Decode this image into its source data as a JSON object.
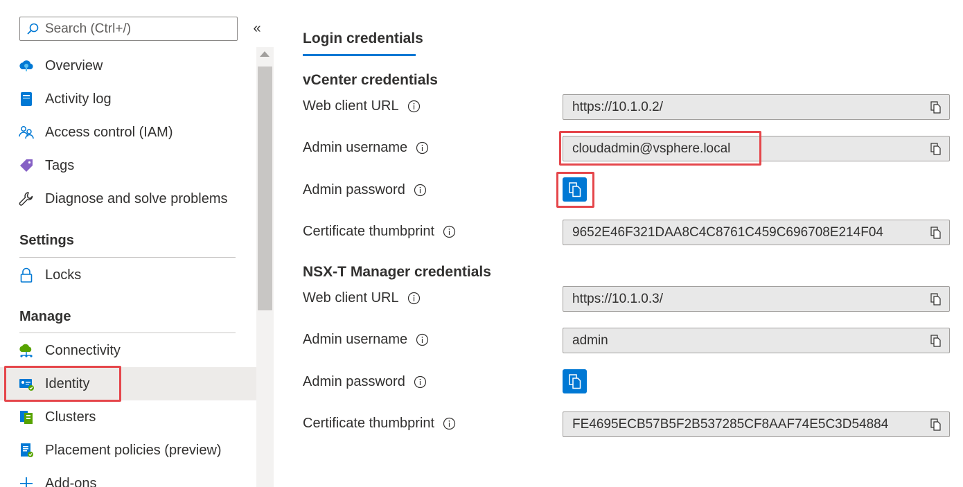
{
  "search": {
    "placeholder": "Search (Ctrl+/)"
  },
  "sidebar": {
    "collapse_glyph": "«",
    "items": [
      {
        "label": "Overview",
        "icon": "overview-cloud-icon"
      },
      {
        "label": "Activity log",
        "icon": "activity-log-icon"
      },
      {
        "label": "Access control (IAM)",
        "icon": "people-icon"
      },
      {
        "label": "Tags",
        "icon": "tag-icon"
      },
      {
        "label": "Diagnose and solve problems",
        "icon": "wrench-icon"
      }
    ],
    "sections": [
      {
        "title": "Settings",
        "items": [
          {
            "label": "Locks",
            "icon": "lock-icon"
          }
        ]
      },
      {
        "title": "Manage",
        "items": [
          {
            "label": "Connectivity",
            "icon": "connectivity-icon"
          },
          {
            "label": "Identity",
            "icon": "identity-card-icon",
            "active": true
          },
          {
            "label": "Clusters",
            "icon": "clusters-icon"
          },
          {
            "label": "Placement policies (preview)",
            "icon": "policy-icon"
          },
          {
            "label": "Add-ons",
            "icon": "plus-icon"
          }
        ]
      }
    ]
  },
  "main": {
    "tab": "Login credentials",
    "vcenter": {
      "title": "vCenter credentials",
      "web_client_url_label": "Web client URL",
      "web_client_url": "https://10.1.0.2/",
      "admin_username_label": "Admin username",
      "admin_username": "cloudadmin@vsphere.local",
      "admin_password_label": "Admin password",
      "cert_thumbprint_label": "Certificate thumbprint",
      "cert_thumbprint": "9652E46F321DAA8C4C8761C459C696708E214F04"
    },
    "nsxt": {
      "title": "NSX-T Manager credentials",
      "web_client_url_label": "Web client URL",
      "web_client_url": "https://10.1.0.3/",
      "admin_username_label": "Admin username",
      "admin_username": "admin",
      "admin_password_label": "Admin password",
      "cert_thumbprint_label": "Certificate thumbprint",
      "cert_thumbprint": "FE4695ECB57B5F2B537285CF8AAF74E5C3D54884"
    }
  },
  "colors": {
    "accent": "#0078d4",
    "highlight": "#e5464b",
    "field_bg": "#e8e8e8"
  }
}
